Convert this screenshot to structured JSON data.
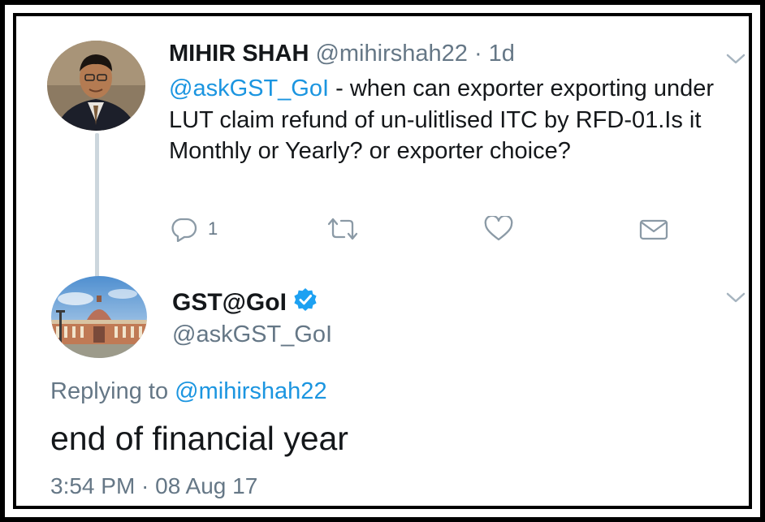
{
  "tweet_original": {
    "author_name": "MIHIR SHAH",
    "author_handle": "@mihirshah22",
    "separator": "·",
    "time_ago": "1d",
    "mention": "@askGST_GoI",
    "text": " - when can exporter exporting under LUT claim refund of un-ulitlised ITC by RFD-01.Is it Monthly or Yearly? or exporter choice?",
    "reply_count": "1",
    "icons": [
      "reply-icon",
      "retweet-icon",
      "like-icon",
      "direct-message-icon",
      "chevron-down-icon"
    ]
  },
  "tweet_reply": {
    "author_name": "GST@GoI",
    "author_handle": "@askGST_GoI",
    "verified": true,
    "replying_to_prefix": "Replying to ",
    "replying_to_handle": "@mihirshah22",
    "text": "end of financial year",
    "timestamp": "3:54 PM · 08 Aug 17",
    "icons": [
      "verified-badge-icon",
      "chevron-down-icon"
    ]
  },
  "colors": {
    "text_primary": "#14171a",
    "text_secondary": "#657786",
    "link_blue": "#1b95e0",
    "verified_blue": "#1da1f2",
    "thread_line": "#ccd6dd",
    "frame": "#000000"
  }
}
